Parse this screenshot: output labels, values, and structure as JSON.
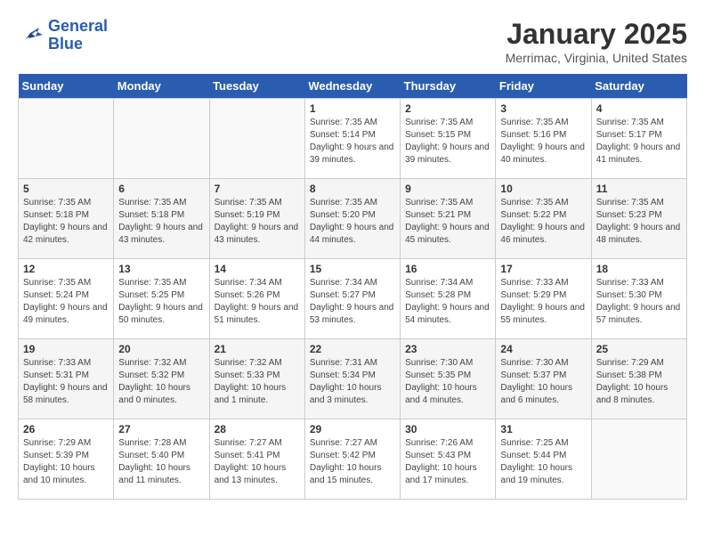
{
  "header": {
    "logo_line1": "General",
    "logo_line2": "Blue",
    "title": "January 2025",
    "subtitle": "Merrimac, Virginia, United States"
  },
  "weekdays": [
    "Sunday",
    "Monday",
    "Tuesday",
    "Wednesday",
    "Thursday",
    "Friday",
    "Saturday"
  ],
  "weeks": [
    [
      {
        "num": "",
        "info": ""
      },
      {
        "num": "",
        "info": ""
      },
      {
        "num": "",
        "info": ""
      },
      {
        "num": "1",
        "info": "Sunrise: 7:35 AM\nSunset: 5:14 PM\nDaylight: 9 hours and 39 minutes."
      },
      {
        "num": "2",
        "info": "Sunrise: 7:35 AM\nSunset: 5:15 PM\nDaylight: 9 hours and 39 minutes."
      },
      {
        "num": "3",
        "info": "Sunrise: 7:35 AM\nSunset: 5:16 PM\nDaylight: 9 hours and 40 minutes."
      },
      {
        "num": "4",
        "info": "Sunrise: 7:35 AM\nSunset: 5:17 PM\nDaylight: 9 hours and 41 minutes."
      }
    ],
    [
      {
        "num": "5",
        "info": "Sunrise: 7:35 AM\nSunset: 5:18 PM\nDaylight: 9 hours and 42 minutes."
      },
      {
        "num": "6",
        "info": "Sunrise: 7:35 AM\nSunset: 5:18 PM\nDaylight: 9 hours and 43 minutes."
      },
      {
        "num": "7",
        "info": "Sunrise: 7:35 AM\nSunset: 5:19 PM\nDaylight: 9 hours and 43 minutes."
      },
      {
        "num": "8",
        "info": "Sunrise: 7:35 AM\nSunset: 5:20 PM\nDaylight: 9 hours and 44 minutes."
      },
      {
        "num": "9",
        "info": "Sunrise: 7:35 AM\nSunset: 5:21 PM\nDaylight: 9 hours and 45 minutes."
      },
      {
        "num": "10",
        "info": "Sunrise: 7:35 AM\nSunset: 5:22 PM\nDaylight: 9 hours and 46 minutes."
      },
      {
        "num": "11",
        "info": "Sunrise: 7:35 AM\nSunset: 5:23 PM\nDaylight: 9 hours and 48 minutes."
      }
    ],
    [
      {
        "num": "12",
        "info": "Sunrise: 7:35 AM\nSunset: 5:24 PM\nDaylight: 9 hours and 49 minutes."
      },
      {
        "num": "13",
        "info": "Sunrise: 7:35 AM\nSunset: 5:25 PM\nDaylight: 9 hours and 50 minutes."
      },
      {
        "num": "14",
        "info": "Sunrise: 7:34 AM\nSunset: 5:26 PM\nDaylight: 9 hours and 51 minutes."
      },
      {
        "num": "15",
        "info": "Sunrise: 7:34 AM\nSunset: 5:27 PM\nDaylight: 9 hours and 53 minutes."
      },
      {
        "num": "16",
        "info": "Sunrise: 7:34 AM\nSunset: 5:28 PM\nDaylight: 9 hours and 54 minutes."
      },
      {
        "num": "17",
        "info": "Sunrise: 7:33 AM\nSunset: 5:29 PM\nDaylight: 9 hours and 55 minutes."
      },
      {
        "num": "18",
        "info": "Sunrise: 7:33 AM\nSunset: 5:30 PM\nDaylight: 9 hours and 57 minutes."
      }
    ],
    [
      {
        "num": "19",
        "info": "Sunrise: 7:33 AM\nSunset: 5:31 PM\nDaylight: 9 hours and 58 minutes."
      },
      {
        "num": "20",
        "info": "Sunrise: 7:32 AM\nSunset: 5:32 PM\nDaylight: 10 hours and 0 minutes."
      },
      {
        "num": "21",
        "info": "Sunrise: 7:32 AM\nSunset: 5:33 PM\nDaylight: 10 hours and 1 minute."
      },
      {
        "num": "22",
        "info": "Sunrise: 7:31 AM\nSunset: 5:34 PM\nDaylight: 10 hours and 3 minutes."
      },
      {
        "num": "23",
        "info": "Sunrise: 7:30 AM\nSunset: 5:35 PM\nDaylight: 10 hours and 4 minutes."
      },
      {
        "num": "24",
        "info": "Sunrise: 7:30 AM\nSunset: 5:37 PM\nDaylight: 10 hours and 6 minutes."
      },
      {
        "num": "25",
        "info": "Sunrise: 7:29 AM\nSunset: 5:38 PM\nDaylight: 10 hours and 8 minutes."
      }
    ],
    [
      {
        "num": "26",
        "info": "Sunrise: 7:29 AM\nSunset: 5:39 PM\nDaylight: 10 hours and 10 minutes."
      },
      {
        "num": "27",
        "info": "Sunrise: 7:28 AM\nSunset: 5:40 PM\nDaylight: 10 hours and 11 minutes."
      },
      {
        "num": "28",
        "info": "Sunrise: 7:27 AM\nSunset: 5:41 PM\nDaylight: 10 hours and 13 minutes."
      },
      {
        "num": "29",
        "info": "Sunrise: 7:27 AM\nSunset: 5:42 PM\nDaylight: 10 hours and 15 minutes."
      },
      {
        "num": "30",
        "info": "Sunrise: 7:26 AM\nSunset: 5:43 PM\nDaylight: 10 hours and 17 minutes."
      },
      {
        "num": "31",
        "info": "Sunrise: 7:25 AM\nSunset: 5:44 PM\nDaylight: 10 hours and 19 minutes."
      },
      {
        "num": "",
        "info": ""
      }
    ]
  ]
}
